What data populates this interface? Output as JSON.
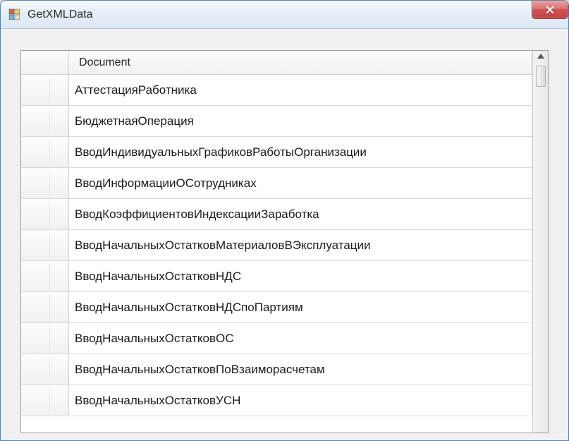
{
  "window": {
    "title": "GetXMLData"
  },
  "grid": {
    "column_header": "Document",
    "rows": [
      "АттестацияРаботника",
      "БюджетнаяОперация",
      "ВводИндивидуальныхГрафиковРаботыОрганизации",
      "ВводИнформацииОСотрудниках",
      "ВводКоэффициентовИндексацииЗаработка",
      "ВводНачальныхОстатковМатериаловВЭксплуатации",
      "ВводНачальныхОстатковНДС",
      "ВводНачальныхОстатковНДСпоПартиям",
      "ВводНачальныхОстатковОС",
      "ВводНачальныхОстатковПоВзаиморасчетам",
      "ВводНачальныхОстатковУСН"
    ]
  }
}
